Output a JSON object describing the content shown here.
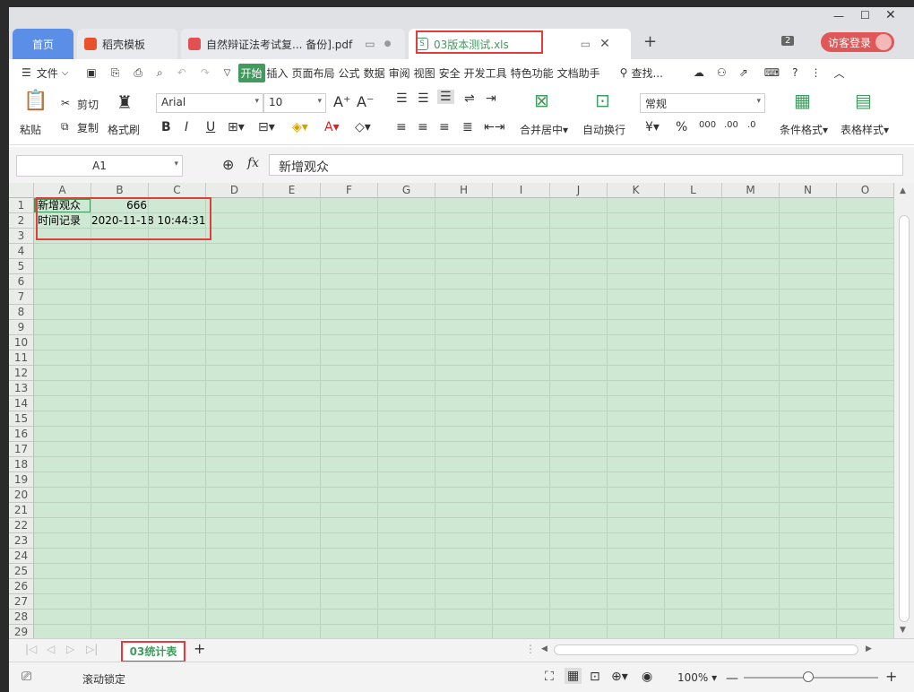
{
  "tabs": {
    "home": "首页",
    "t1": "稻壳模板",
    "t2": "自然辩证法考试复... 备份].pdf",
    "t3": "03版本测试.xls",
    "plus": "+",
    "count": "2",
    "login": "访客登录"
  },
  "menu": {
    "file": "文件",
    "items": [
      "开始",
      "插入",
      "页面布局",
      "公式",
      "数据",
      "审阅",
      "视图",
      "安全",
      "开发工具",
      "特色功能",
      "文档助手"
    ],
    "search": "查找..."
  },
  "ribbon": {
    "paste": "粘贴",
    "cut": "剪切",
    "copy": "复制",
    "format_painter": "格式刷",
    "font": "Arial",
    "size": "10",
    "merge": "合并居中",
    "wrap": "自动换行",
    "num_format": "常规",
    "cond_format": "条件格式",
    "table_style": "表格样式"
  },
  "formula": {
    "cell_ref": "A1",
    "fx": "fx",
    "value": "新增观众"
  },
  "columns": [
    "A",
    "B",
    "C",
    "D",
    "E",
    "F",
    "G",
    "H",
    "I",
    "J",
    "K",
    "L",
    "M",
    "N",
    "O"
  ],
  "rows": [
    "1",
    "2",
    "3",
    "4",
    "5",
    "6",
    "7",
    "8",
    "9",
    "10",
    "11",
    "12",
    "13",
    "14",
    "15",
    "16",
    "17",
    "18",
    "19",
    "20",
    "21",
    "22",
    "23",
    "24",
    "25",
    "26",
    "27",
    "28",
    "29"
  ],
  "cells": {
    "a1": "新增观众",
    "b1": "666",
    "a2": "时间记录",
    "b2": "2020-11-18 10:44:31"
  },
  "sheet_tab": "03统计表",
  "status": {
    "scroll_lock": "滚动锁定",
    "zoom": "100%"
  },
  "colors": {
    "accent": "#3f9c5c",
    "grid_bg": "#cfe8d3",
    "home_tab": "#5b8ee6",
    "highlight": "#e23c3c"
  }
}
